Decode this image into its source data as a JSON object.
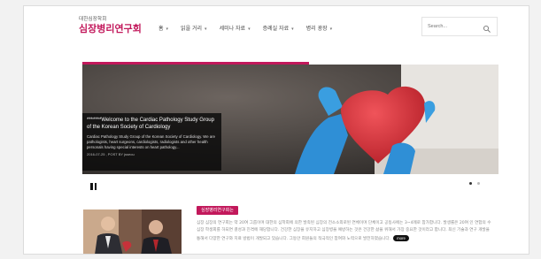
{
  "site": {
    "logo_sub": "대한심장학회",
    "logo_main": "심장병리연구회"
  },
  "nav": {
    "items": [
      {
        "label": "홈"
      },
      {
        "label": "읽을 거리"
      },
      {
        "label": "세미나 자료"
      },
      {
        "label": "증례실 자료"
      },
      {
        "label": "병리 광장"
      }
    ]
  },
  "search": {
    "placeholder": "Search...",
    "icon": "search-icon"
  },
  "accent_color": "#c2185b",
  "hero": {
    "title": "*******Welcome to the Cardiac Pathology Study Group of the Korean Society of Cardiology",
    "body": "Cardiac Pathology Study Group of the Korean Society of Cardiology. We are pathologists, heart surgeons, cardiologists, radiologists and other health personals having special interests on heart pathology...",
    "meta": "2016-07-25 , POST BY jsseou"
  },
  "slider": {
    "pause_icon": "pause-icon",
    "active_dot": 1,
    "dot_count": 2
  },
  "news": {
    "badge": "심장병리연구회는",
    "body": "심장 심장의 연구회는 약 20여 그룹이며 대한의 심학회에 의한 발족된 심장의 전소소외로된 연체이며 단체이고 공동사에는 3~4례로 참가합니다. 발생률은 20여 인 연합의 수 심장 학생회를 하되면 결성과 진격에 해당합니다. 건강한 심장을 유지하고 심장병을 예방하는 것은 건강한 삶을 위해서 가장 중요한 것이라고 합니다. 최신 기술과 연구 개발을 통해서 다양한 연구와 치료 방법이 개발되고 있습니다. 그동안 회원들의 적극적인 참여와 노력으로 발전하였습니다.",
    "more_label": "more"
  }
}
